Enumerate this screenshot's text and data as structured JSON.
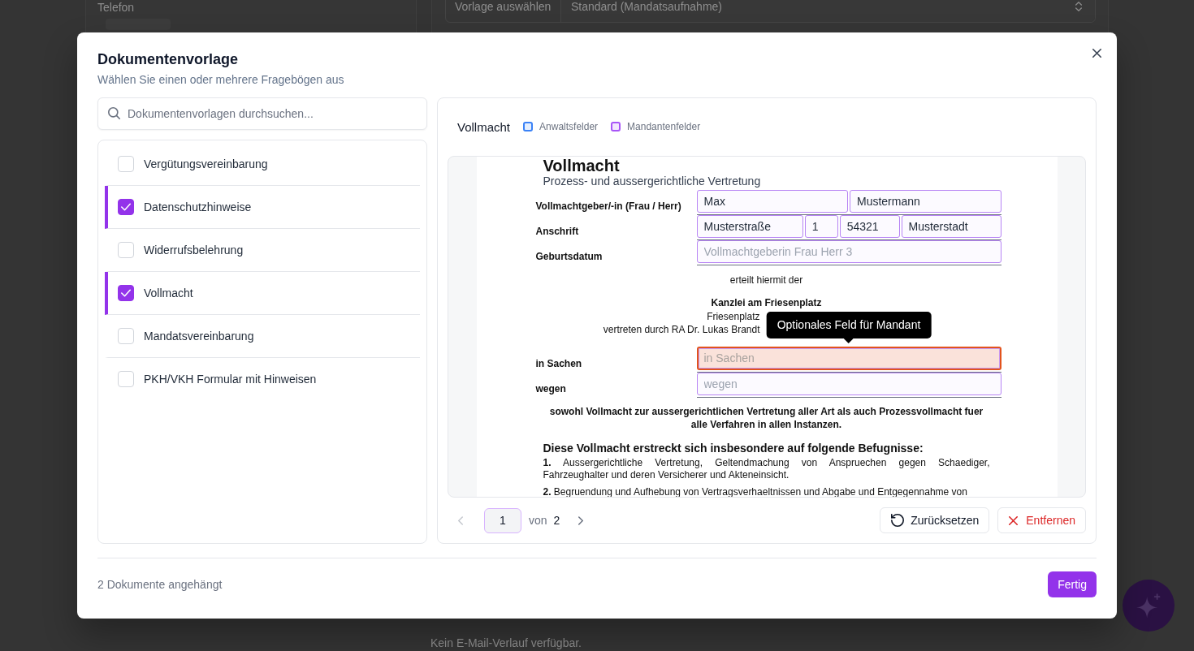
{
  "background": {
    "contact_label": "Telefon",
    "template_label": "Vorlage auswählen",
    "template_select": "Standard (Mandatsaufnahme)",
    "email_empty": "Kein E-Mail-Verlauf verfügbar."
  },
  "dialog": {
    "title": "Dokumentenvorlage",
    "subtitle": "Wählen Sie einen oder mehrere Fragebögen aus"
  },
  "search": {
    "placeholder": "Dokumentenvorlagen durchsuchen..."
  },
  "templates": [
    {
      "label": "Vergütungsvereinbarung",
      "checked": false
    },
    {
      "label": "Datenschutzhinweise",
      "checked": true
    },
    {
      "label": "Widerrufsbelehrung",
      "checked": false
    },
    {
      "label": "Vollmacht",
      "checked": true
    },
    {
      "label": "Mandatsvereinbarung",
      "checked": false
    },
    {
      "label": "PKH/VKH Formular mit Hinweisen",
      "checked": false
    }
  ],
  "preview": {
    "title": "Vollmacht",
    "legend": [
      {
        "label": "Anwaltsfelder",
        "color": "#3b82f6"
      },
      {
        "label": "Mandantenfelder",
        "color": "#a855f7"
      }
    ],
    "document": {
      "heading": "Vollmacht",
      "subheading": "Prozess- und aussergerichtliche Vertretung",
      "party_rows": [
        {
          "label": "Vollmachtgeber/-in (Frau / Herr)",
          "fields": [
            {
              "value": "Max",
              "highlighted": false
            },
            {
              "value": "Mustermann",
              "highlighted": false
            }
          ]
        },
        {
          "label": "Anschrift",
          "fields": [
            {
              "value": "Musterstraße",
              "highlighted": false
            },
            {
              "value": "1",
              "highlighted": false
            },
            {
              "value": "54321",
              "highlighted": false
            },
            {
              "value": "Musterstadt",
              "highlighted": false
            }
          ]
        },
        {
          "label": "Geburtsdatum",
          "fields": [
            {
              "placeholder": "Vollmachtgeberin Frau Herr 3",
              "highlighted": false
            }
          ]
        }
      ],
      "grant": "erteilt hiermit der",
      "firm": {
        "name": "Kanzlei am Friesenplatz",
        "address": "Friesenplatz",
        "representative": "vertreten durch RA Dr. Lukas Brandt"
      },
      "case_rows": [
        {
          "label": "in Sachen",
          "fields": [
            {
              "placeholder": "in Sachen",
              "highlighted": true,
              "tooltip": "Optionales Feld für Mandant"
            }
          ]
        },
        {
          "label": "wegen",
          "fields": [
            {
              "placeholder": "wegen",
              "highlighted": false
            }
          ]
        }
      ],
      "scope": "sowohl Vollmacht zur aussergerichtlichen Vertretung aller Art als auch Prozessvollmacht fuer alle Verfahren in allen Instanzen.",
      "powers_heading": "Diese Vollmacht erstreckt sich insbesondere auf folgende Befugnisse:",
      "powers": [
        "**1.** Aussergerichtliche Vertretung, Geltendmachung von Anspruechen gegen Schaediger, Fahrzeughalter und deren Versicherer und Akteneinsicht.",
        "**2.** Begruendung und Aufhebung von Vertragsverhaeltnissen und Abgabe und Entgegennahme von"
      ]
    },
    "pager": {
      "page": "1",
      "separator": "von",
      "total": "2",
      "previous_disabled": true,
      "next_disabled": false
    },
    "actions": [
      {
        "kind": "reset",
        "label": "Zurücksetzen"
      },
      {
        "kind": "remove",
        "label": "Entfernen"
      }
    ]
  },
  "footer": {
    "status": "2 Dokumente angehängt",
    "done": "Fertig"
  }
}
